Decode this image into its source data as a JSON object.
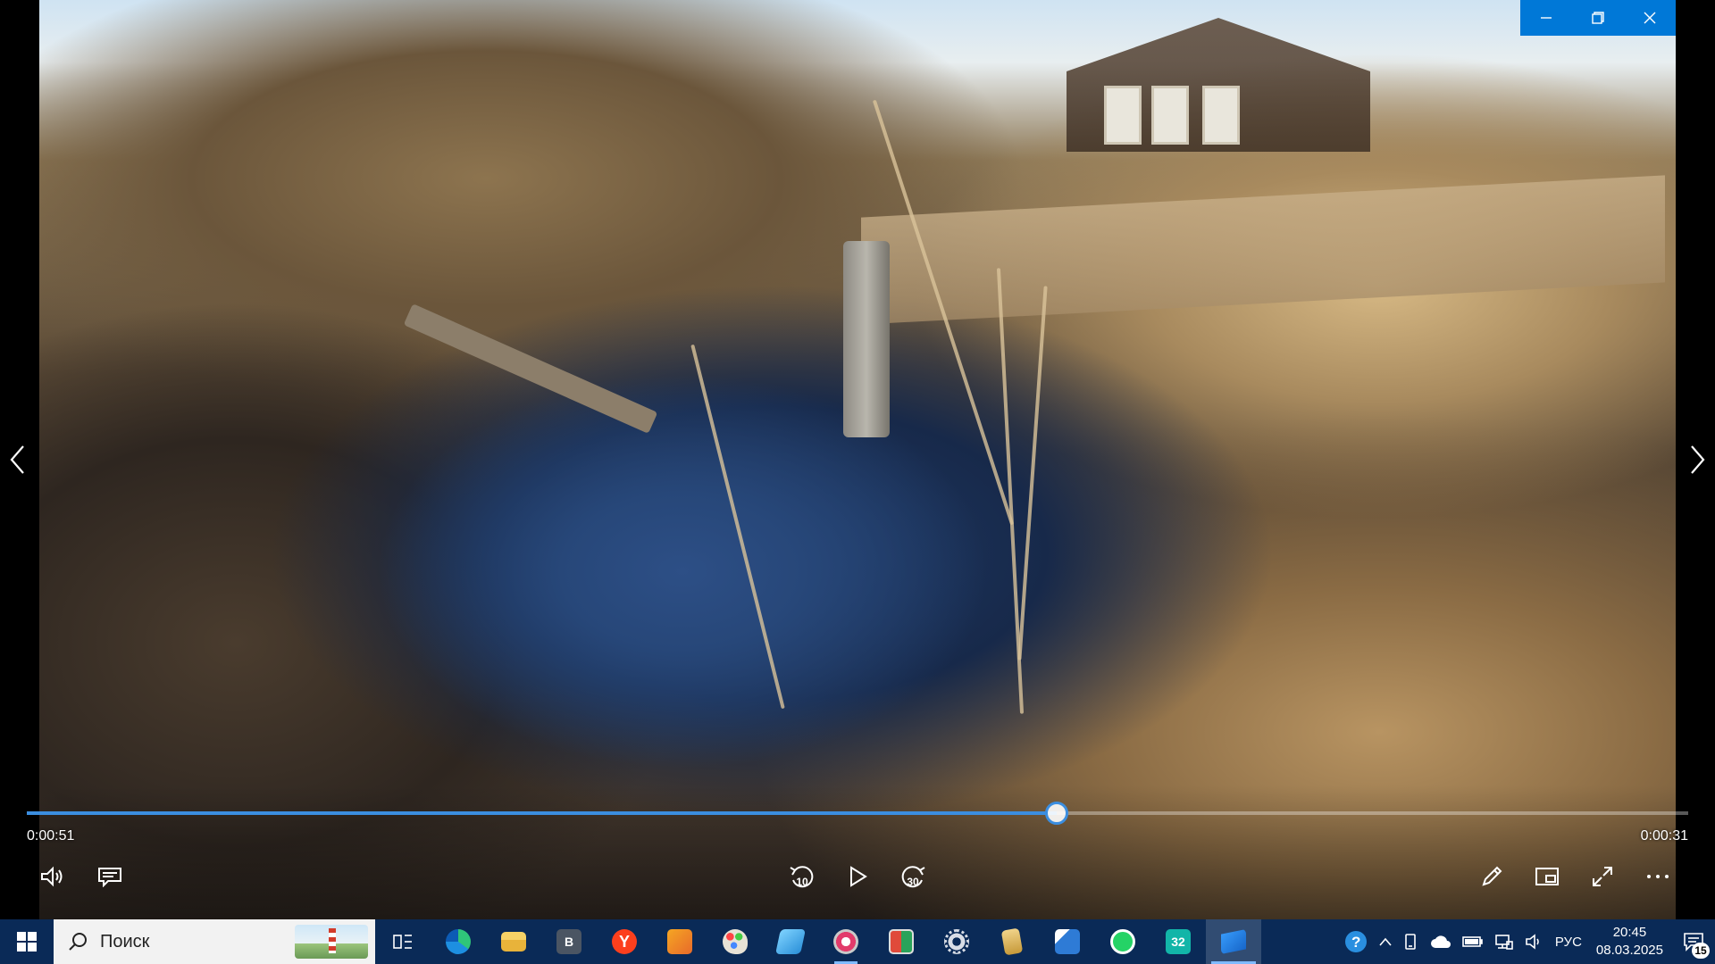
{
  "player": {
    "elapsed": "0:00:51",
    "remaining": "0:00:31",
    "progress_percent": 62.0,
    "skip_back_seconds": "10",
    "skip_forward_seconds": "30",
    "accent": "#3b8ee0"
  },
  "taskbar": {
    "search_placeholder": "Поиск",
    "pinned": [
      {
        "name": "task-view-icon"
      },
      {
        "name": "edge-icon"
      },
      {
        "name": "file-explorer-icon"
      },
      {
        "name": "app-b-icon",
        "letter": "B"
      },
      {
        "name": "yandex-browser-icon",
        "letter": "Y"
      },
      {
        "name": "media-app-icon"
      },
      {
        "name": "paint-icon"
      },
      {
        "name": "notes-app-icon"
      },
      {
        "name": "snipping-tool-icon"
      },
      {
        "name": "window-app-icon"
      },
      {
        "name": "settings-gear-icon"
      },
      {
        "name": "document-app-icon"
      },
      {
        "name": "remote-desktop-icon"
      },
      {
        "name": "whatsapp-icon"
      },
      {
        "name": "app-32-icon",
        "letter": "32"
      },
      {
        "name": "movies-tv-icon"
      }
    ],
    "tray": {
      "language": "РУС",
      "time": "20:45",
      "date": "08.03.2025",
      "notifications_count": "15"
    }
  }
}
